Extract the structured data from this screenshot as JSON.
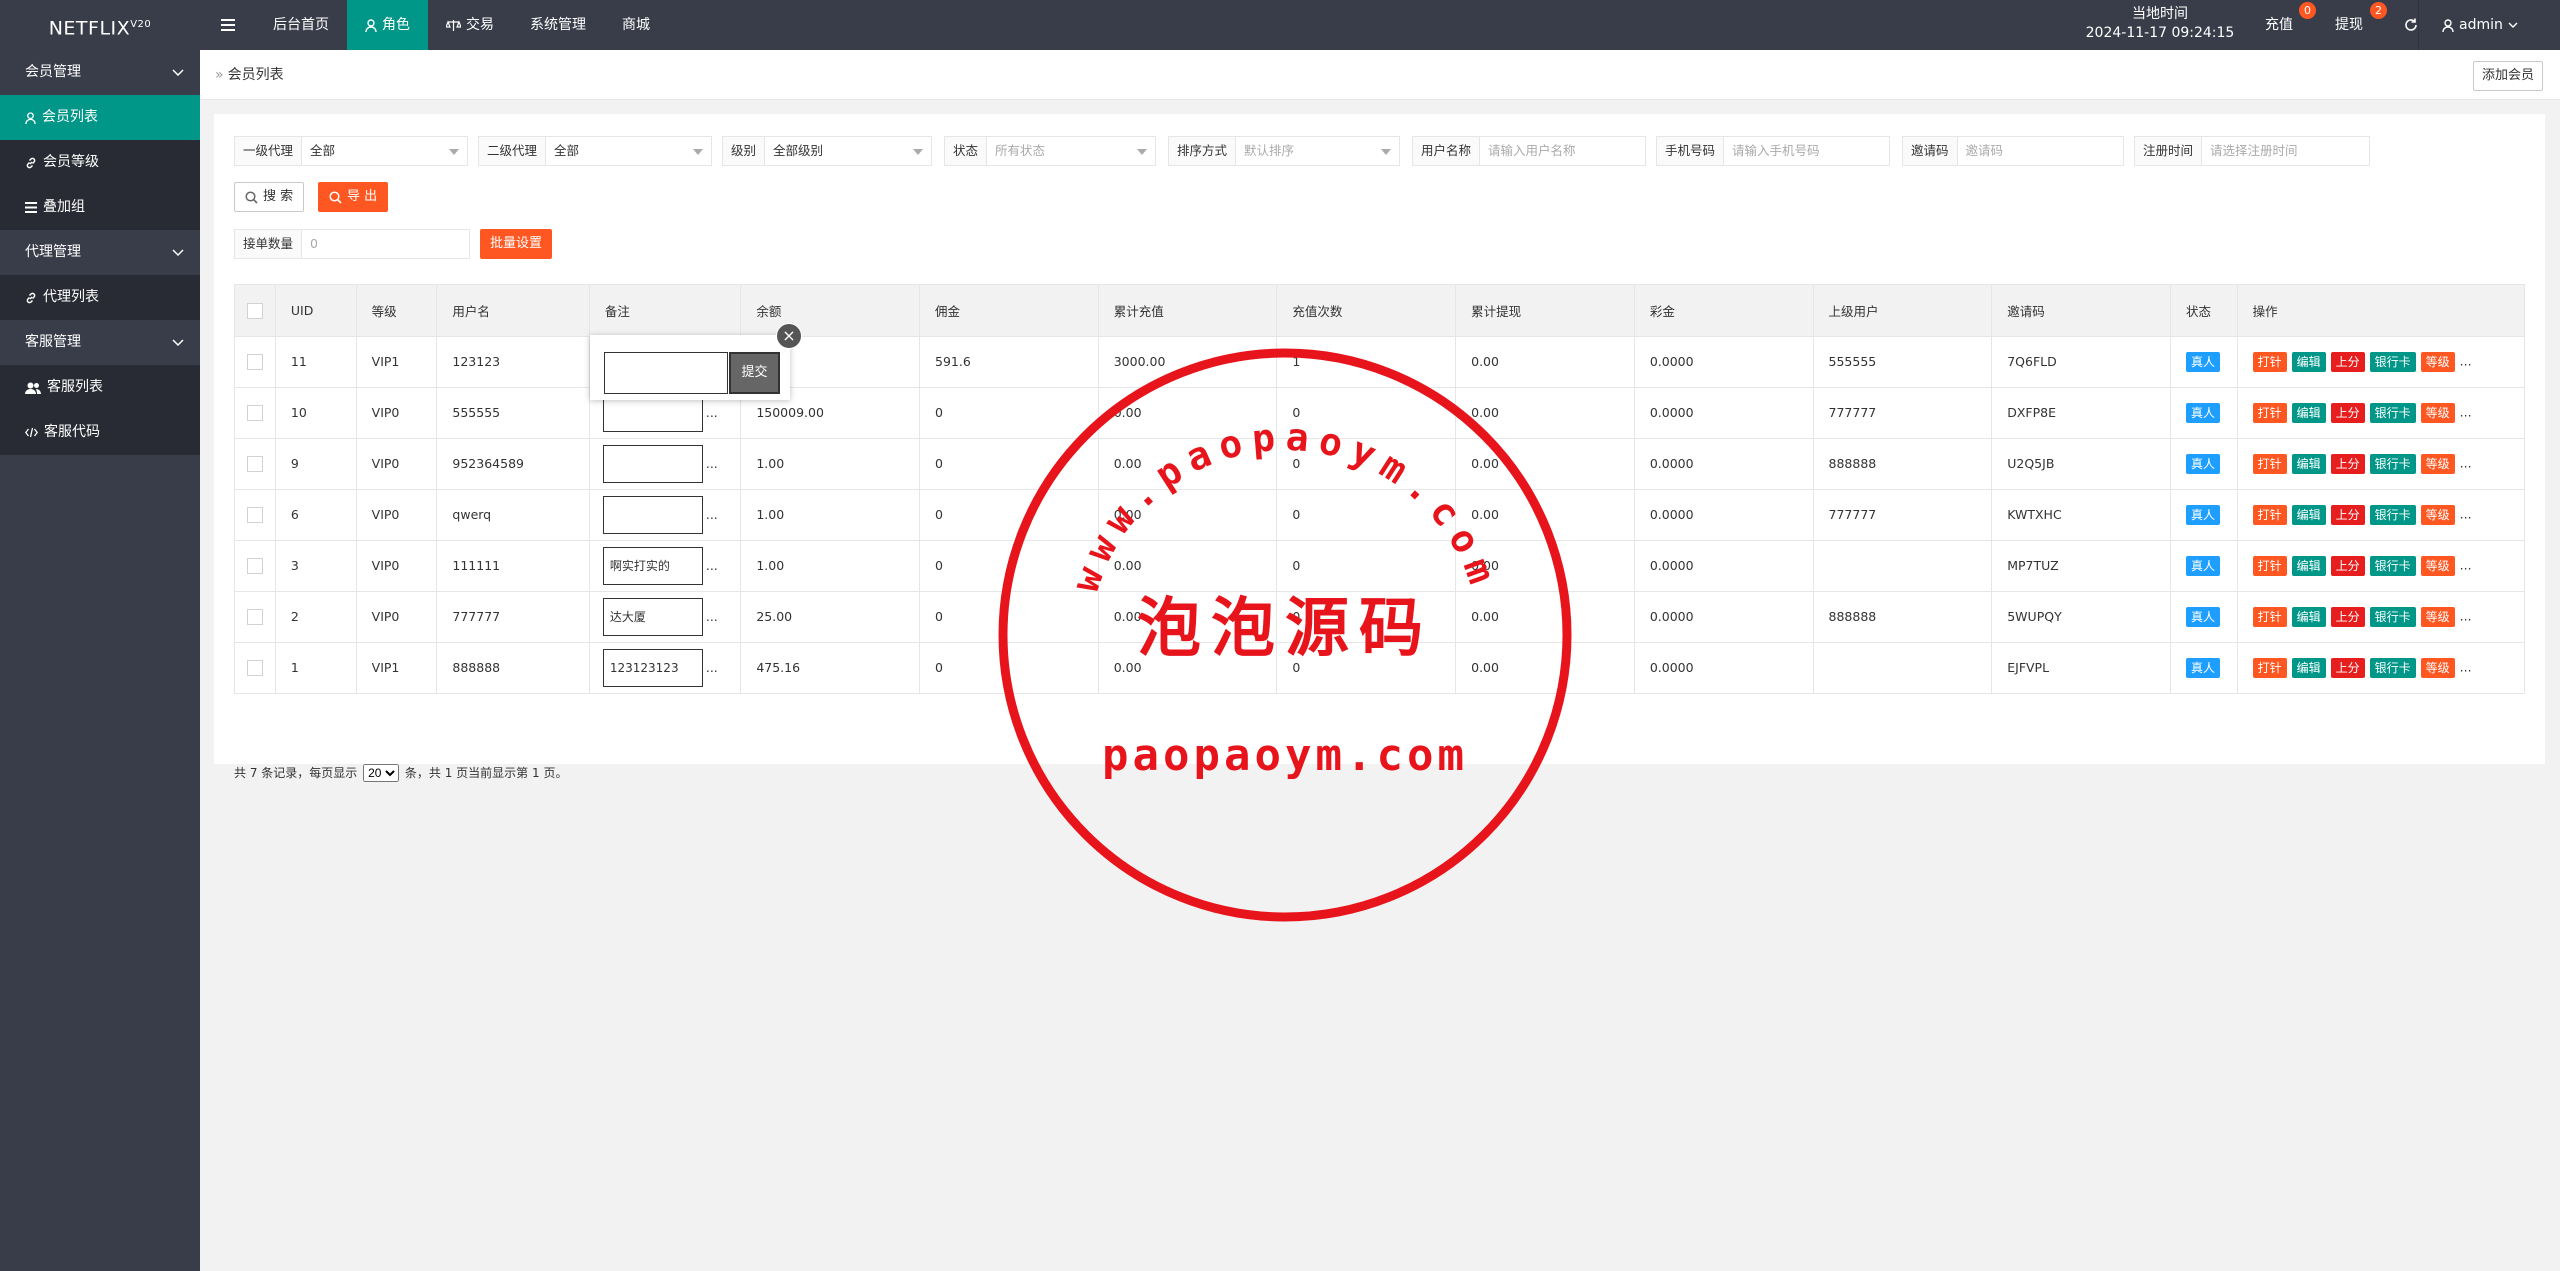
{
  "app": {
    "logo": "NETFLIX",
    "logo_version": "V20"
  },
  "topnav": {
    "items": [
      {
        "label": "后台首页",
        "icon": ""
      },
      {
        "label": "角色",
        "icon": "user-icon",
        "active": true
      },
      {
        "label": "交易",
        "icon": "scale-icon"
      },
      {
        "label": "系统管理",
        "icon": ""
      },
      {
        "label": "商城",
        "icon": ""
      }
    ],
    "clock_label": "当地时间",
    "clock_value": "2024-11-17 09:24:15",
    "recharge": "充值",
    "recharge_badge": "0",
    "withdraw": "提现",
    "withdraw_badge": "2",
    "user": "admin"
  },
  "sidebar": {
    "groups": [
      {
        "label": "会员管理",
        "items": [
          {
            "label": "会员列表",
            "icon": "user-icon",
            "active": true
          },
          {
            "label": "会员等级",
            "icon": "link-icon"
          },
          {
            "label": "叠加组",
            "icon": "list-icon"
          }
        ]
      },
      {
        "label": "代理管理",
        "items": [
          {
            "label": "代理列表",
            "icon": "link-icon"
          }
        ]
      },
      {
        "label": "客服管理",
        "items": [
          {
            "label": "客服列表",
            "icon": "users-icon"
          },
          {
            "label": "客服代码",
            "icon": "code-icon"
          }
        ]
      }
    ]
  },
  "breadcrumb": {
    "sep": "»",
    "current": "会员列表"
  },
  "add_button": "添加会员",
  "filters": {
    "agent1": {
      "label": "一级代理",
      "value": "全部"
    },
    "agent2": {
      "label": "二级代理",
      "value": "全部"
    },
    "level": {
      "label": "级别",
      "value": "全部级别"
    },
    "status": {
      "label": "状态",
      "placeholder": "所有状态"
    },
    "sort": {
      "label": "排序方式",
      "placeholder": "默认排序"
    },
    "username": {
      "label": "用户名称",
      "placeholder": "请输入用户名称"
    },
    "phone": {
      "label": "手机号码",
      "placeholder": "请输入手机号码"
    },
    "invite": {
      "label": "邀请码",
      "placeholder": "邀请码"
    },
    "regtime": {
      "label": "注册时间",
      "placeholder": "请选择注册时间"
    }
  },
  "search_button": "搜 索",
  "export_button": "导 出",
  "order_count": {
    "label": "接单数量",
    "placeholder": "0"
  },
  "batch_button": "批量设置",
  "table": {
    "headers": [
      "UID",
      "等级",
      "用户名",
      "备注",
      "余额",
      "佣金",
      "累计充值",
      "充值次数",
      "累计提现",
      "彩金",
      "上级用户",
      "邀请码",
      "状态",
      "操作"
    ],
    "rows": [
      {
        "uid": "11",
        "level": "VIP1",
        "username": "123123",
        "note": "",
        "balance": "",
        "commission": "591.6",
        "total_recharge": "3000.00",
        "recharge_times": "1",
        "total_withdraw": "0.00",
        "bonus": "0.0000",
        "parent": "555555",
        "invite": "7Q6FLD",
        "status": "真人"
      },
      {
        "uid": "10",
        "level": "VIP0",
        "username": "555555",
        "note": "",
        "balance": "150009.00",
        "commission": "0",
        "total_recharge": "0.00",
        "recharge_times": "0",
        "total_withdraw": "0.00",
        "bonus": "0.0000",
        "parent": "777777",
        "invite": "DXFP8E",
        "status": "真人"
      },
      {
        "uid": "9",
        "level": "VIP0",
        "username": "952364589",
        "note": "",
        "balance": "1.00",
        "commission": "0",
        "total_recharge": "0.00",
        "recharge_times": "0",
        "total_withdraw": "0.00",
        "bonus": "0.0000",
        "parent": "888888",
        "invite": "U2Q5JB",
        "status": "真人"
      },
      {
        "uid": "6",
        "level": "VIP0",
        "username": "qwerq",
        "note": "",
        "balance": "1.00",
        "commission": "0",
        "total_recharge": "0.00",
        "recharge_times": "0",
        "total_withdraw": "0.00",
        "bonus": "0.0000",
        "parent": "777777",
        "invite": "KWTXHC",
        "status": "真人"
      },
      {
        "uid": "3",
        "level": "VIP0",
        "username": "111111",
        "note": "啊实打实的",
        "balance": "1.00",
        "commission": "0",
        "total_recharge": "0.00",
        "recharge_times": "0",
        "total_withdraw": "0.00",
        "bonus": "0.0000",
        "parent": "",
        "invite": "MP7TUZ",
        "status": "真人"
      },
      {
        "uid": "2",
        "level": "VIP0",
        "username": "777777",
        "note": "达大厦",
        "balance": "25.00",
        "commission": "0",
        "total_recharge": "0.00",
        "recharge_times": "0",
        "total_withdraw": "0.00",
        "bonus": "0.0000",
        "parent": "888888",
        "invite": "5WUPQY",
        "status": "真人"
      },
      {
        "uid": "1",
        "level": "VIP1",
        "username": "888888",
        "note": "123123123",
        "balance": "475.16",
        "commission": "0",
        "total_recharge": "0.00",
        "recharge_times": "0",
        "total_withdraw": "0.00",
        "bonus": "0.0000",
        "parent": "",
        "invite": "EJFVPL",
        "status": "真人"
      }
    ],
    "actions": [
      "打针",
      "编辑",
      "上分",
      "银行卡",
      "等级"
    ],
    "more": "...",
    "note_dots": "..."
  },
  "pager": {
    "prefix": "共 7 条记录，每页显示",
    "per_page": "20",
    "suffix": "条，共 1 页当前显示第 1 页。"
  },
  "popup": {
    "submit": "提交",
    "close": "×"
  },
  "watermark": {
    "arc_text": "www.paopaoym.com",
    "center_text": "泡泡源码",
    "bottom_text": "paopaoym.com",
    "color": "#e8141b"
  },
  "colors": {
    "teal": "#009688",
    "orange": "#ff5722",
    "blue": "#1e9fff",
    "red": "#e61e1e",
    "dark": "#393d49"
  }
}
